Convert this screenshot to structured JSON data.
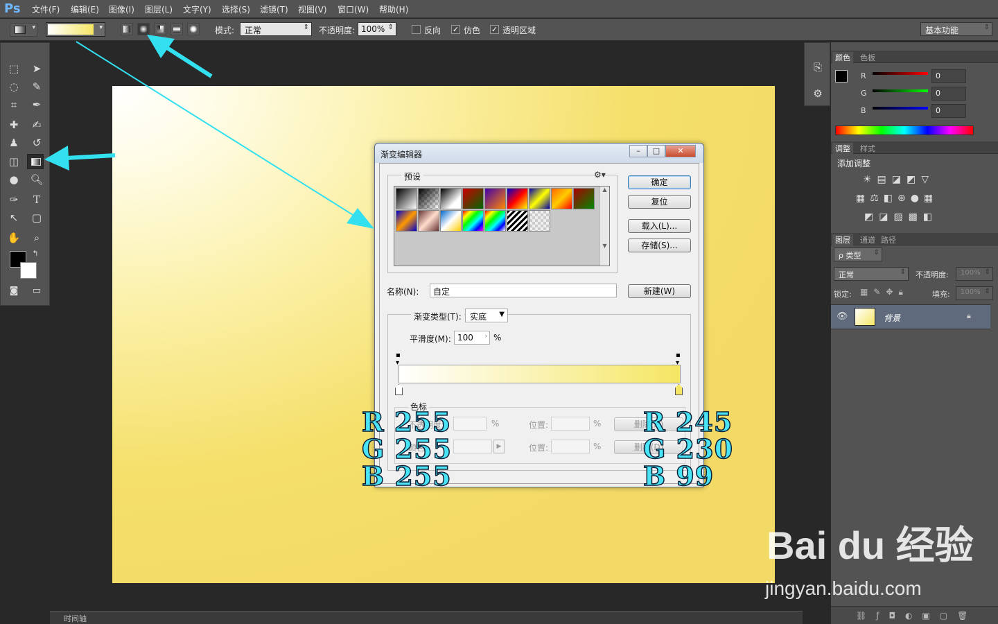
{
  "app": {
    "logo": "Ps"
  },
  "menu": [
    "文件(F)",
    "编辑(E)",
    "图像(I)",
    "图层(L)",
    "文字(Y)",
    "选择(S)",
    "滤镜(T)",
    "视图(V)",
    "窗口(W)",
    "帮助(H)"
  ],
  "options": {
    "mode_label": "模式:",
    "mode_value": "正常",
    "opacity_label": "不透明度:",
    "opacity_value": "100%",
    "reverse_label": "反向",
    "dither_label": "仿色",
    "transparency_label": "透明区域",
    "reverse_checked": false,
    "dither_checked": true,
    "transparency_checked": true,
    "workspace": "基本功能"
  },
  "color_panel": {
    "tabs": [
      "颜色",
      "色板"
    ],
    "r_label": "R",
    "g_label": "G",
    "b_label": "B",
    "r_value": "0",
    "g_value": "0",
    "b_value": "0"
  },
  "adjust_panel": {
    "tabs": [
      "调整",
      "样式"
    ],
    "title": "添加调整"
  },
  "layers_panel": {
    "tabs": [
      "图层",
      "通道",
      "路径"
    ],
    "filter": "ρ 类型",
    "blend": "正常",
    "opacity_label": "不透明度:",
    "opacity_value": "100%",
    "lock_label": "锁定:",
    "fill_label": "填充:",
    "fill_value": "100%",
    "layer_name": "背景"
  },
  "timeline": {
    "label": "时间轴"
  },
  "dialog": {
    "title": "渐变编辑器",
    "presets_label": "预设",
    "ok": "确定",
    "reset": "复位",
    "load": "载入(L)...",
    "save": "存储(S)...",
    "name_label": "名称(N):",
    "name_value": "自定",
    "new_button": "新建(W)",
    "type_label": "渐变类型(T):",
    "type_value": "实底",
    "smooth_label": "平滑度(M):",
    "smooth_value": "100",
    "smooth_unit": "%",
    "stops_label": "色标",
    "opacity_label": "不透明度:",
    "color_label": "颜色:",
    "location_label": "位置:",
    "percent": "%",
    "delete": "删除(D)",
    "gradient_start": "#ffffff",
    "gradient_end": "#f5e663"
  },
  "annotations": {
    "left": [
      "R 255",
      "G 255",
      "B 255"
    ],
    "right": [
      "R 245",
      "G 230",
      "B 99"
    ]
  },
  "watermark": {
    "brand": "Bai du 经验",
    "url": "jingyan.baidu.com"
  }
}
